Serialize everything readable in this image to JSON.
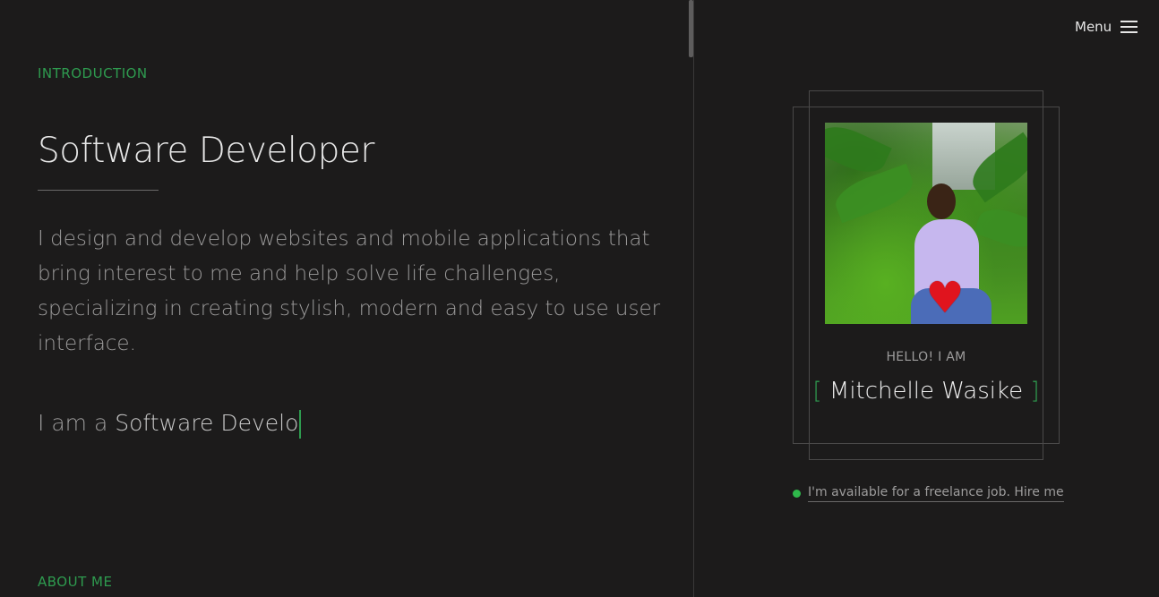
{
  "intro": {
    "section_label": "INTRODUCTION",
    "title": "Software Developer",
    "description": "I design and develop websites and mobile applications that bring interest to me and help solve life challenges, specializing in creating stylish, modern and easy to use user interface.",
    "typed_prefix": "I am a",
    "typed_text": "Software Develo"
  },
  "about": {
    "section_label": "ABOUT ME"
  },
  "header": {
    "menu_label": "Menu"
  },
  "profile": {
    "greeting": "HELLO! I AM",
    "name": "Mitchelle Wasike",
    "bracket_open": "[",
    "bracket_close": "]",
    "photo_emoji": "♥"
  },
  "availability": {
    "text": "I'm available for a freelance job. Hire me"
  },
  "colors": {
    "background": "#1c1b1b",
    "accent": "#2e9b4f",
    "status_dot": "#2fb84b"
  },
  "icons": {
    "menu": "hamburger-icon",
    "status": "green-dot-icon"
  }
}
